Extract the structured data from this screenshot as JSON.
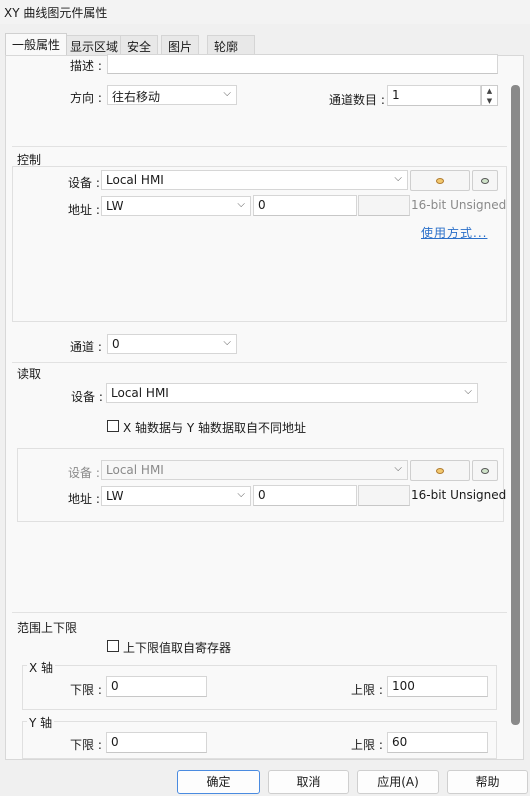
{
  "window": {
    "title": "XY 曲线图元件属性"
  },
  "tabs": [
    "一般属性",
    "显示区域",
    "安全",
    "图片",
    "轮廓"
  ],
  "general": {
    "desc_label": "描述 :",
    "desc_value": "",
    "direction_label": "方向 :",
    "direction_value": "往右移动",
    "channel_count_label": "通道数目 :",
    "channel_count_value": "1"
  },
  "control": {
    "section_label": "控制",
    "device_label": "设备 :",
    "device_value": "Local HMI",
    "address_label": "地址 :",
    "address_type": "LW",
    "address_value": "0",
    "format": "16-bit Unsigned",
    "usage_link": "使用方式..."
  },
  "channel": {
    "label": "通道 :",
    "value": "0"
  },
  "read": {
    "section_label": "读取",
    "device_label": "设备 :",
    "device_value": "Local HMI",
    "separate_addr_label": "X 轴数据与 Y 轴数据取自不同地址",
    "sub_device_label": "设备 :",
    "sub_device_value": "Local HMI",
    "sub_address_label": "地址 :",
    "sub_address_type": "LW",
    "sub_address_value": "0",
    "sub_format": "16-bit Unsigned"
  },
  "range": {
    "section_label": "范围上下限",
    "from_register_label": "上下限值取自寄存器",
    "x_axis": {
      "label": "X 轴",
      "lower_label": "下限 :",
      "lower": "0",
      "upper_label": "上限 :",
      "upper": "100"
    },
    "y_axis": {
      "label": "Y 轴",
      "lower_label": "下限 :",
      "lower": "0",
      "upper_label": "上限 :",
      "upper": "60"
    }
  },
  "buttons": {
    "ok": "确定",
    "cancel": "取消",
    "apply": "应用(A)",
    "help": "帮助"
  }
}
